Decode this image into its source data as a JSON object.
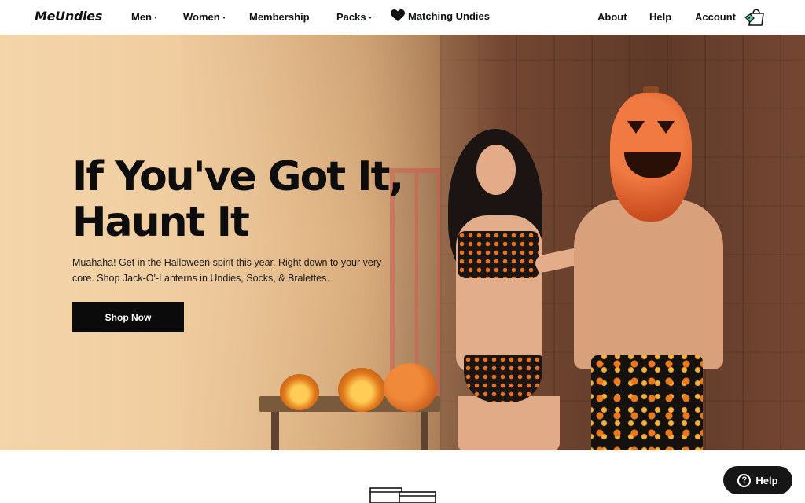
{
  "brand": {
    "logo": "MeUndies"
  },
  "nav": {
    "left": [
      {
        "label": "Men",
        "dropdown": true
      },
      {
        "label": "Women",
        "dropdown": true
      },
      {
        "label": "Membership",
        "dropdown": false
      },
      {
        "label": "Packs",
        "dropdown": true
      },
      {
        "label": "Matching Undies",
        "icon": "heart-icon"
      }
    ],
    "right": [
      {
        "label": "About"
      },
      {
        "label": "Help"
      },
      {
        "label": "Account"
      }
    ],
    "cart_icon": "shopping-bag-icon"
  },
  "hero": {
    "title_line1": "If You've Got It,",
    "title_line2": "Haunt It",
    "subtitle": "Muahaha! Get in the Halloween spirit this year. Right down to your very core. Shop Jack-O'-Lanterns in Undies, Socks, & Bralettes.",
    "cta": "Shop Now"
  },
  "help_widget": {
    "label": "Help",
    "icon": "question-icon",
    "glyph": "?"
  },
  "colors": {
    "accent_dark": "#0b0b0b",
    "hero_sand": "#f2d2a6",
    "pumpkin_orange": "#e8731f"
  }
}
